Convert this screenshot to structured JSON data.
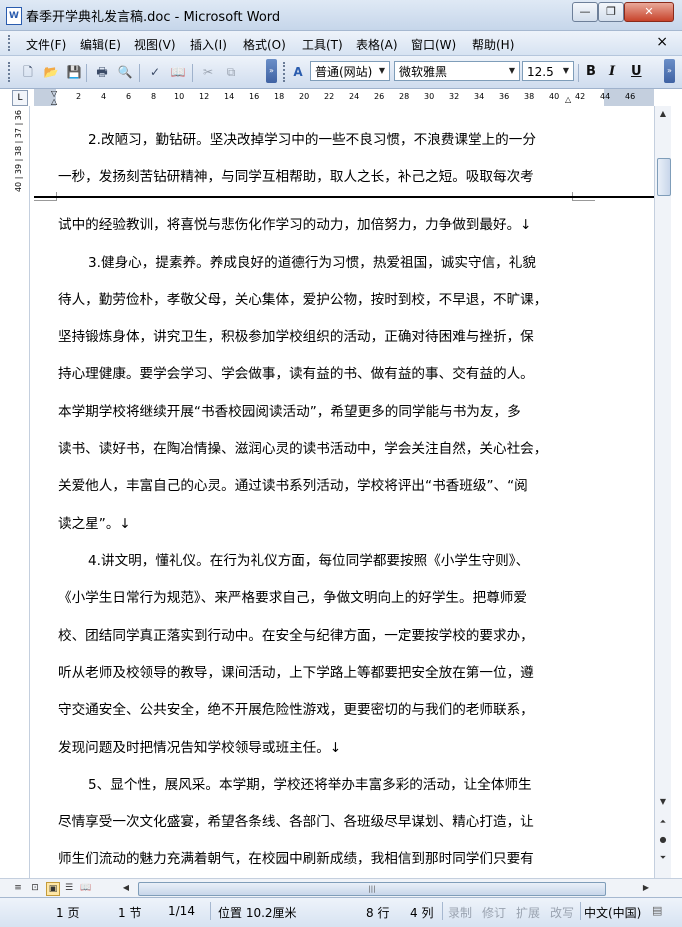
{
  "window": {
    "title": "春季开学典礼发言稿.doc - Microsoft Word",
    "minimize": "—",
    "restore": "❐",
    "close": "✕"
  },
  "menu": {
    "items": [
      "文件(F)",
      "编辑(E)",
      "视图(V)",
      "插入(I)",
      "格式(O)",
      "工具(T)",
      "表格(A)",
      "窗口(W)",
      "帮助(H)"
    ],
    "close_doc": "×"
  },
  "toolbar": {
    "style_value": "普通(网站)",
    "font_value": "微软雅黑",
    "size_value": "12.5",
    "bold": "B",
    "italic": "I",
    "underline": "U",
    "style_icon_label": "A"
  },
  "ruler": {
    "ticks": [
      "2",
      "4",
      "6",
      "8",
      "10",
      "12",
      "14",
      "16",
      "18",
      "20",
      "22",
      "24",
      "26",
      "28",
      "30",
      "32",
      "34",
      "36",
      "38",
      "40",
      "42",
      "44",
      "46"
    ],
    "corner": "L",
    "vertical": "40 | 39 | 38 | 37 | 36"
  },
  "document": {
    "lines": [
      "2.改陋习，勤钻研。坚决改掉学习中的一些不良习惯，不浪费课堂上的一分",
      "一秒，发扬刻苦钻研精神，与同学互相帮助，取人之长，补己之短。吸取每次考",
      "试中的经验教训，将喜悦与悲伤化作学习的动力，加倍努力，力争做到最好。↓",
      "3.健身心，提素养。养成良好的道德行为习惯，热爱祖国，诚实守信，礼貌",
      "待人，勤劳俭朴，孝敬父母，关心集体，爱护公物，按时到校，不早退，不旷课，",
      "坚持锻炼身体，讲究卫生，积极参加学校组织的活动，正确对待困难与挫折，保",
      "持心理健康。要学会学习、学会做事，读有益的书、做有益的事、交有益的人。",
      "本学期学校将继续开展“书香校园阅读活动”，希望更多的同学能与书为友，多",
      "读书、读好书，在陶冶情操、滋润心灵的读书活动中，学会关注自然，关心社会，",
      "关爱他人，丰富自己的心灵。通过读书系列活动，学校将评出“书香班级”、“阅",
      "读之星”。↓",
      "4.讲文明，懂礼仪。在行为礼仪方面，每位同学都要按照《小学生守则》、",
      "《小学生日常行为规范》、来严格要求自己，争做文明向上的好学生。把尊师爱",
      "校、团结同学真正落实到行动中。在安全与纪律方面，一定要按学校的要求办，",
      "听从老师及校领导的教导，课间活动，上下学路上等都要把安全放在第一位，遵",
      "守交通安全、公共安全，绝不开展危险性游戏，更要密切的与我们的老师联系，",
      "发现问题及时把情况告知学校领导或班主任。↓",
      "5、显个性，展风采。本学期，学校还将举办丰富多彩的活动，让全体师生",
      "尽情享受一次文化盛宴，希望各条线、各部门、各班级尽早谋划、精心打造，让",
      "师生们流动的魅力充满着朝气，在校园中刷新成绩，我相信到那时同学们只要有"
    ]
  },
  "status": {
    "page": "1 页",
    "section": "1 节",
    "page_of": "1/14",
    "position": "位置 10.2厘米",
    "line": "8 行",
    "column": "4 列",
    "rec": "录制",
    "trk": "修订",
    "ext": "扩展",
    "ovr": "改写",
    "language": "中文(中国)"
  }
}
